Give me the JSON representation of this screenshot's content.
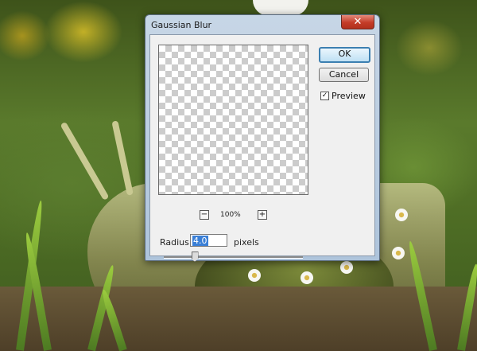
{
  "dialog": {
    "title": "Gaussian Blur",
    "close_glyph": "✕",
    "ok_label": "OK",
    "cancel_label": "Cancel",
    "preview_checkbox": {
      "label": "Preview",
      "checked": true,
      "glyph": "✓"
    },
    "zoom": {
      "out_glyph": "−",
      "in_glyph": "+",
      "level": "100%"
    },
    "radius": {
      "label": "Radius:",
      "value": "4.0",
      "unit": "pixels"
    },
    "slider": {
      "value": 4.0,
      "fraction": 0.22
    }
  },
  "icons": [
    "close-icon",
    "zoom-out-icon",
    "zoom-in-icon",
    "checkmark-icon",
    "slider-thumb"
  ],
  "colors": {
    "close_button": "#c43c28",
    "default_button_border": "#3c7fb1",
    "selection": "#3a7fd6",
    "window_frame": "#aec4db"
  }
}
